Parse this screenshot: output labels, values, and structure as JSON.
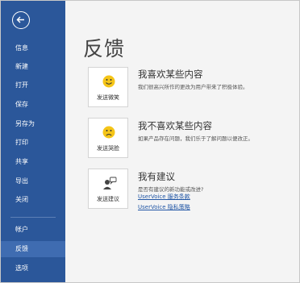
{
  "sidebar": {
    "items": [
      {
        "label": "信息"
      },
      {
        "label": "新建"
      },
      {
        "label": "打开"
      },
      {
        "label": "保存"
      },
      {
        "label": "另存为"
      },
      {
        "label": "打印"
      },
      {
        "label": "共享"
      },
      {
        "label": "导出"
      },
      {
        "label": "关闭"
      },
      {
        "label": "帐户"
      },
      {
        "label": "反馈"
      },
      {
        "label": "选项"
      }
    ],
    "active_item": "反馈"
  },
  "main": {
    "title": "反馈",
    "sections": [
      {
        "card_label": "发送微笑",
        "card_icon": "smiley-icon",
        "title": "我喜欢某些内容",
        "description": "我们很高兴所作的更改为用户带来了积极体验。"
      },
      {
        "card_label": "发送哭脸",
        "card_icon": "frown-icon",
        "title": "我不喜欢某些内容",
        "description": "如果产品存在问题，我们乐于了解问题以便改正。"
      },
      {
        "card_label": "发送建议",
        "card_icon": "suggestion-icon",
        "title": "我有建议",
        "description": "是否有建议的新功能或改进?",
        "links": [
          "UserVoice 服务条款",
          "UserVoice 隐私策略"
        ]
      }
    ]
  },
  "colors": {
    "sidebar_bg": "#2b579a",
    "sidebar_active": "#3f6cb1",
    "link": "#2156a5",
    "emoji_yellow": "#f5c518"
  }
}
